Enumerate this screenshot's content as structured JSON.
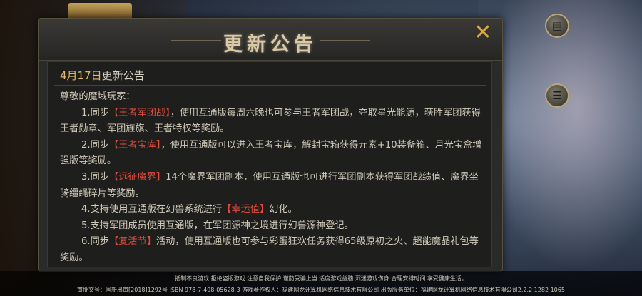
{
  "dialog": {
    "title": "更新公告",
    "close_icon": "close-icon"
  },
  "announcement": {
    "date": "4月17日",
    "title_suffix": "更新公告",
    "greeting": "尊敬的魔域玩家：",
    "items": [
      {
        "prefix": "1.同步",
        "highlight": "【王者军团战】",
        "text": "，使用互通版每周六晚也可参与王者军团战，夺取星光能源，获胜军团获得王者勋章、军团旌旗、王者特权等奖励。"
      },
      {
        "prefix": "2.同步",
        "highlight": "【王者宝库】",
        "text": "，使用互通版可以进入王者宝库，解封宝箱获得元素+10装备箱、月光宝盒增强版等奖励。"
      },
      {
        "prefix": "3.同步",
        "highlight": "【远征魔界】",
        "text": "14个魔界军团副本，使用互通版也可进行军团副本获得军团战绩值、魔界坐骑缰绳碎片等奖励。"
      },
      {
        "prefix": "4.支持使用互通版在幻兽系统进行",
        "highlight": "【幸运值】",
        "text": "幻化。"
      },
      {
        "prefix": "5.支持军团成员使用互通版，在军团源神之境进行幻兽源神登记。",
        "highlight": "",
        "text": ""
      },
      {
        "prefix": "6.同步",
        "highlight": "【复活节】",
        "text": "活动，使用互通版也可参与彩蛋狂欢任务获得65级原初之火、超能魔晶礼包等奖励。"
      }
    ]
  },
  "footer": {
    "line1": "抵制不良游戏 拒绝盗版游戏 注意自我保护 谨防受骗上当 适度游戏益脑 沉迷游戏伤身 合理安排时间 享受健康生活。",
    "line2": "审批文号：国新出审[2018]1292号 ISBN 978-7-498-05628-3   游戏著作权人：福建网龙计算机网络信息技术有限公司  出版服务单位：福建网龙计算机网络信息技术有限公司2.2.2  1282  1065"
  },
  "side_buttons": [
    {
      "icon": "document-icon"
    },
    {
      "icon": "notes-icon"
    }
  ],
  "colors": {
    "highlight": "#e04a3c",
    "title": "#d9c9a7",
    "close": "#d6a94a"
  }
}
